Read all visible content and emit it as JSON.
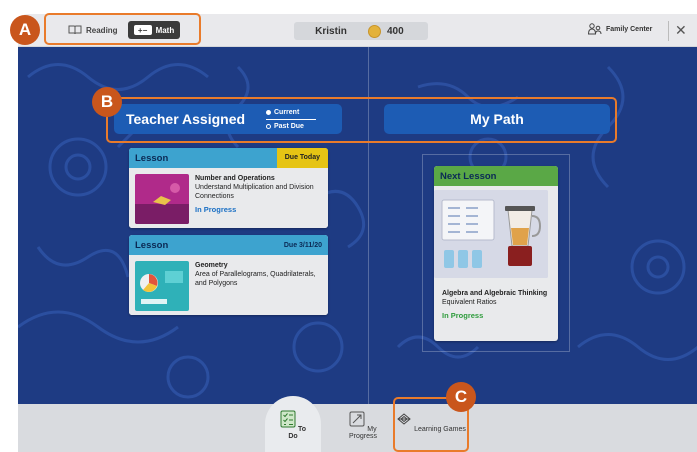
{
  "topbar": {
    "subjects": [
      {
        "label": "Reading",
        "icon": "book-icon",
        "active": false
      },
      {
        "label": "Math",
        "icon": "math-icon",
        "active": true
      }
    ],
    "student_name": "Kristin",
    "coins": "400",
    "family_center": "Family Center",
    "close": "✕"
  },
  "header": {
    "teacher_assigned": "Teacher Assigned",
    "toggle_current": "Current",
    "toggle_past_due": "Past Due",
    "my_path": "My Path"
  },
  "lessons": [
    {
      "type": "Lesson",
      "due": "Due Today",
      "title": "Number and Operations",
      "subtitle": "Understand Multiplication and Division Connections",
      "status": "In Progress"
    },
    {
      "type": "Lesson",
      "due": "Due 3/11/20",
      "title": "Geometry",
      "subtitle": "Area of Parallelograms, Quadrilaterals, and Polygons",
      "status": ""
    }
  ],
  "next_lesson": {
    "head": "Next Lesson",
    "title": "Algebra and Algebraic Thinking",
    "subtitle": "Equivalent Ratios",
    "status": "In Progress"
  },
  "bottom_nav": [
    {
      "label": "To Do",
      "icon": "checklist-icon",
      "active": true
    },
    {
      "label": "My Progress",
      "icon": "progress-icon",
      "active": false
    },
    {
      "label": "Learning Games",
      "icon": "games-icon",
      "active": false
    }
  ],
  "annotations": {
    "a": "A",
    "b": "B",
    "c": "C"
  },
  "colors": {
    "accent_orange": "#e97b2b",
    "badge": "#c9561c",
    "tab_blue": "#1d5cb4",
    "lesson_head": "#3da3cf",
    "next_head": "#5aa846",
    "due_yellow": "#e6c414"
  }
}
